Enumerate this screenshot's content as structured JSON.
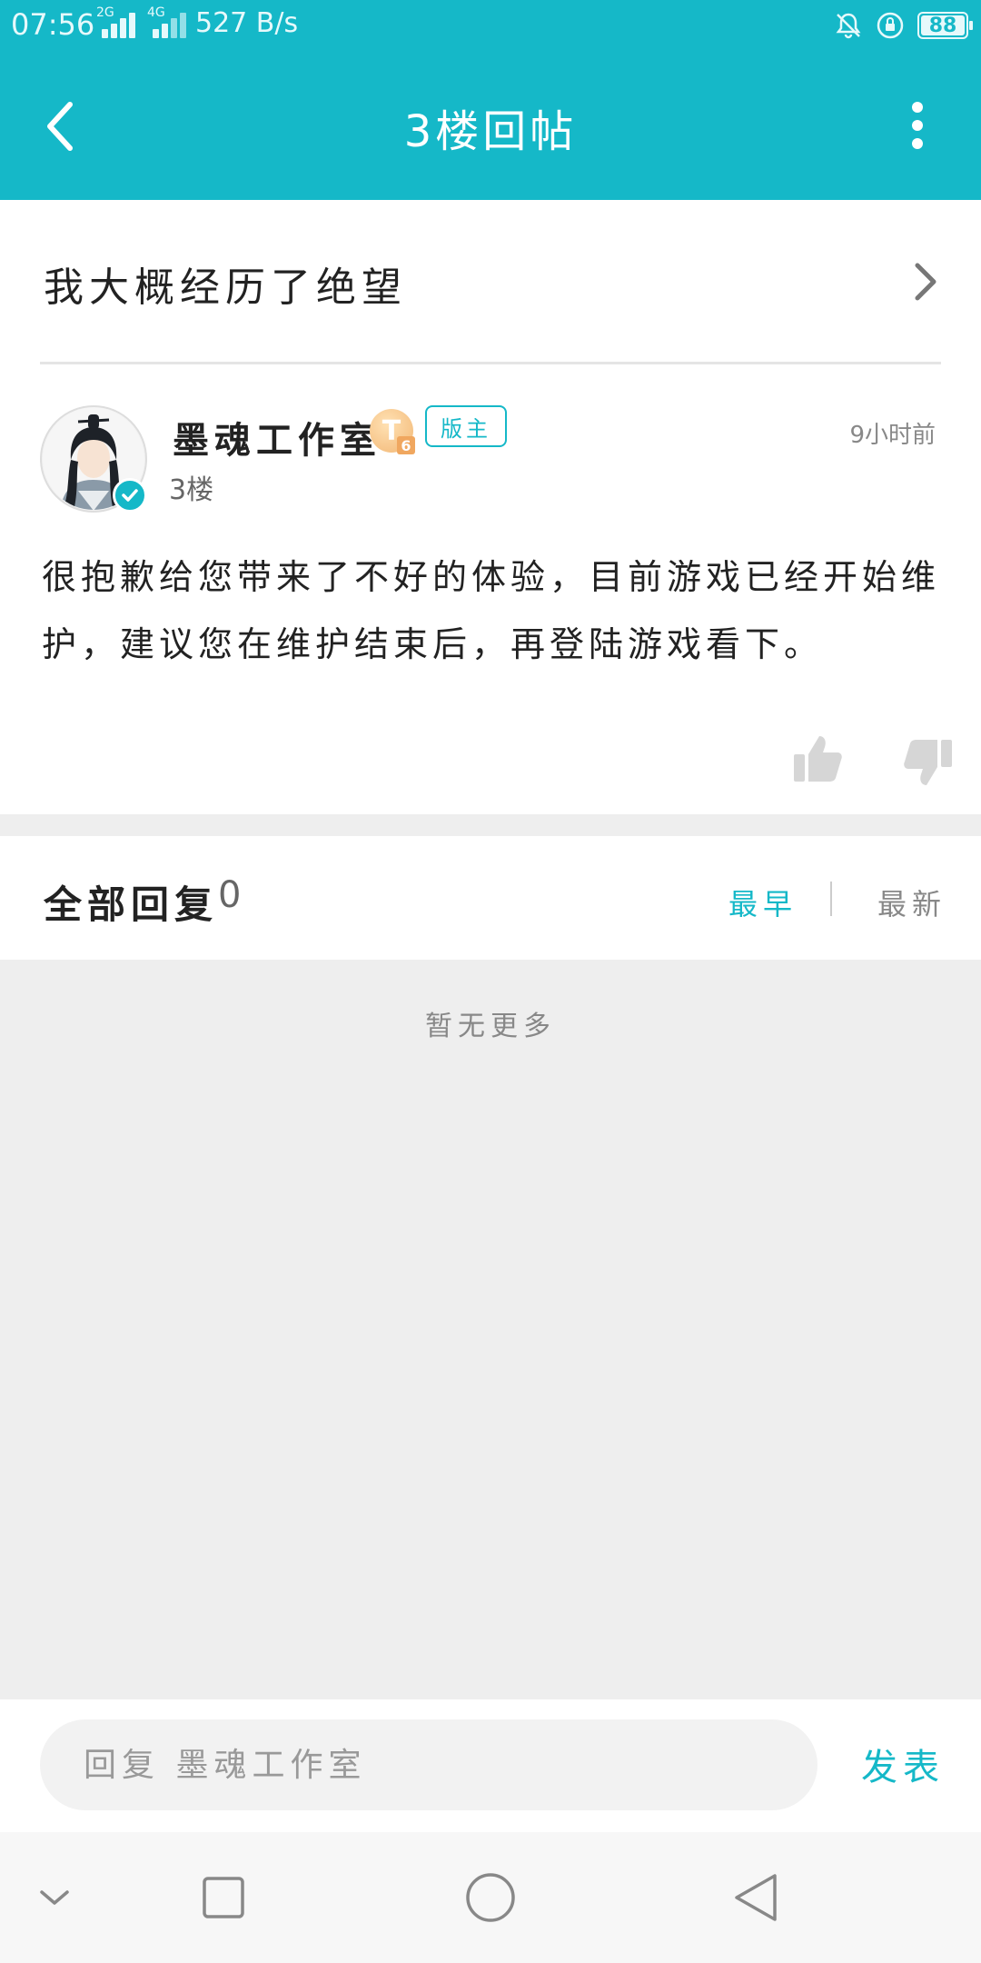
{
  "status_bar": {
    "time": "07:56",
    "network_1": "2G",
    "network_2": "4G",
    "speed": "527 B/s",
    "battery": "88"
  },
  "header": {
    "title": "3楼回帖",
    "back_icon": "chevron-left-icon",
    "more_icon": "more-vertical-icon"
  },
  "thread": {
    "title": "我大概经历了绝望"
  },
  "post": {
    "author": "墨魂工作室",
    "level_badge": "T",
    "level_sub": "6",
    "role_badge": "版主",
    "time": "9小时前",
    "floor": "3楼",
    "body": "很抱歉给您带来了不好的体验，目前游戏已经开始维护，建议您在维护结束后，再登陆游戏看下。"
  },
  "replies": {
    "title": "全部回复",
    "count": "0",
    "sort_earliest": "最早",
    "sort_newest": "最新",
    "empty_text": "暂无更多"
  },
  "reply_bar": {
    "placeholder": "回复 墨魂工作室",
    "publish_label": "发表"
  },
  "colors": {
    "accent": "#15b8c8",
    "background_gray": "#eeeeee"
  }
}
